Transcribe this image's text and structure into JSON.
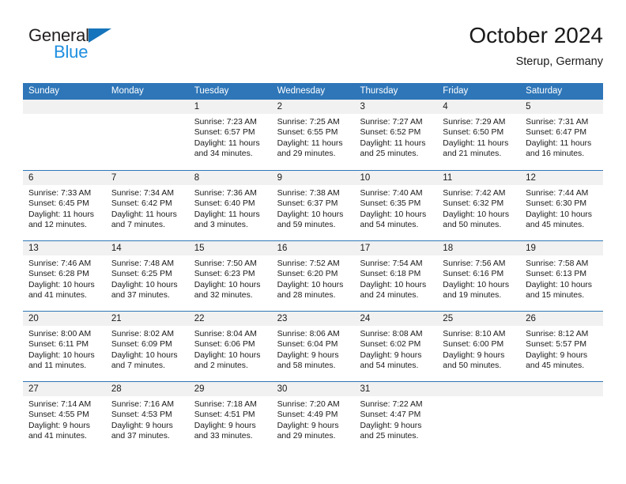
{
  "brand": {
    "name_top": "General",
    "name_bottom": "Blue",
    "triangle_icon": "triangle-icon",
    "color_dark": "#231f20",
    "color_blue": "#1f8fe0"
  },
  "header": {
    "title": "October 2024",
    "subtitle": "Sterup, Germany"
  },
  "theme": {
    "header_blue": "#2e76b8",
    "daynum_band": "#f1f1f1",
    "text": "#1a1a1a"
  },
  "weekdays": [
    "Sunday",
    "Monday",
    "Tuesday",
    "Wednesday",
    "Thursday",
    "Friday",
    "Saturday"
  ],
  "weeks": [
    [
      {
        "day": "",
        "lines": []
      },
      {
        "day": "",
        "lines": []
      },
      {
        "day": "1",
        "lines": [
          "Sunrise: 7:23 AM",
          "Sunset: 6:57 PM",
          "Daylight: 11 hours",
          "and 34 minutes."
        ]
      },
      {
        "day": "2",
        "lines": [
          "Sunrise: 7:25 AM",
          "Sunset: 6:55 PM",
          "Daylight: 11 hours",
          "and 29 minutes."
        ]
      },
      {
        "day": "3",
        "lines": [
          "Sunrise: 7:27 AM",
          "Sunset: 6:52 PM",
          "Daylight: 11 hours",
          "and 25 minutes."
        ]
      },
      {
        "day": "4",
        "lines": [
          "Sunrise: 7:29 AM",
          "Sunset: 6:50 PM",
          "Daylight: 11 hours",
          "and 21 minutes."
        ]
      },
      {
        "day": "5",
        "lines": [
          "Sunrise: 7:31 AM",
          "Sunset: 6:47 PM",
          "Daylight: 11 hours",
          "and 16 minutes."
        ]
      }
    ],
    [
      {
        "day": "6",
        "lines": [
          "Sunrise: 7:33 AM",
          "Sunset: 6:45 PM",
          "Daylight: 11 hours",
          "and 12 minutes."
        ]
      },
      {
        "day": "7",
        "lines": [
          "Sunrise: 7:34 AM",
          "Sunset: 6:42 PM",
          "Daylight: 11 hours",
          "and 7 minutes."
        ]
      },
      {
        "day": "8",
        "lines": [
          "Sunrise: 7:36 AM",
          "Sunset: 6:40 PM",
          "Daylight: 11 hours",
          "and 3 minutes."
        ]
      },
      {
        "day": "9",
        "lines": [
          "Sunrise: 7:38 AM",
          "Sunset: 6:37 PM",
          "Daylight: 10 hours",
          "and 59 minutes."
        ]
      },
      {
        "day": "10",
        "lines": [
          "Sunrise: 7:40 AM",
          "Sunset: 6:35 PM",
          "Daylight: 10 hours",
          "and 54 minutes."
        ]
      },
      {
        "day": "11",
        "lines": [
          "Sunrise: 7:42 AM",
          "Sunset: 6:32 PM",
          "Daylight: 10 hours",
          "and 50 minutes."
        ]
      },
      {
        "day": "12",
        "lines": [
          "Sunrise: 7:44 AM",
          "Sunset: 6:30 PM",
          "Daylight: 10 hours",
          "and 45 minutes."
        ]
      }
    ],
    [
      {
        "day": "13",
        "lines": [
          "Sunrise: 7:46 AM",
          "Sunset: 6:28 PM",
          "Daylight: 10 hours",
          "and 41 minutes."
        ]
      },
      {
        "day": "14",
        "lines": [
          "Sunrise: 7:48 AM",
          "Sunset: 6:25 PM",
          "Daylight: 10 hours",
          "and 37 minutes."
        ]
      },
      {
        "day": "15",
        "lines": [
          "Sunrise: 7:50 AM",
          "Sunset: 6:23 PM",
          "Daylight: 10 hours",
          "and 32 minutes."
        ]
      },
      {
        "day": "16",
        "lines": [
          "Sunrise: 7:52 AM",
          "Sunset: 6:20 PM",
          "Daylight: 10 hours",
          "and 28 minutes."
        ]
      },
      {
        "day": "17",
        "lines": [
          "Sunrise: 7:54 AM",
          "Sunset: 6:18 PM",
          "Daylight: 10 hours",
          "and 24 minutes."
        ]
      },
      {
        "day": "18",
        "lines": [
          "Sunrise: 7:56 AM",
          "Sunset: 6:16 PM",
          "Daylight: 10 hours",
          "and 19 minutes."
        ]
      },
      {
        "day": "19",
        "lines": [
          "Sunrise: 7:58 AM",
          "Sunset: 6:13 PM",
          "Daylight: 10 hours",
          "and 15 minutes."
        ]
      }
    ],
    [
      {
        "day": "20",
        "lines": [
          "Sunrise: 8:00 AM",
          "Sunset: 6:11 PM",
          "Daylight: 10 hours",
          "and 11 minutes."
        ]
      },
      {
        "day": "21",
        "lines": [
          "Sunrise: 8:02 AM",
          "Sunset: 6:09 PM",
          "Daylight: 10 hours",
          "and 7 minutes."
        ]
      },
      {
        "day": "22",
        "lines": [
          "Sunrise: 8:04 AM",
          "Sunset: 6:06 PM",
          "Daylight: 10 hours",
          "and 2 minutes."
        ]
      },
      {
        "day": "23",
        "lines": [
          "Sunrise: 8:06 AM",
          "Sunset: 6:04 PM",
          "Daylight: 9 hours",
          "and 58 minutes."
        ]
      },
      {
        "day": "24",
        "lines": [
          "Sunrise: 8:08 AM",
          "Sunset: 6:02 PM",
          "Daylight: 9 hours",
          "and 54 minutes."
        ]
      },
      {
        "day": "25",
        "lines": [
          "Sunrise: 8:10 AM",
          "Sunset: 6:00 PM",
          "Daylight: 9 hours",
          "and 50 minutes."
        ]
      },
      {
        "day": "26",
        "lines": [
          "Sunrise: 8:12 AM",
          "Sunset: 5:57 PM",
          "Daylight: 9 hours",
          "and 45 minutes."
        ]
      }
    ],
    [
      {
        "day": "27",
        "lines": [
          "Sunrise: 7:14 AM",
          "Sunset: 4:55 PM",
          "Daylight: 9 hours",
          "and 41 minutes."
        ]
      },
      {
        "day": "28",
        "lines": [
          "Sunrise: 7:16 AM",
          "Sunset: 4:53 PM",
          "Daylight: 9 hours",
          "and 37 minutes."
        ]
      },
      {
        "day": "29",
        "lines": [
          "Sunrise: 7:18 AM",
          "Sunset: 4:51 PM",
          "Daylight: 9 hours",
          "and 33 minutes."
        ]
      },
      {
        "day": "30",
        "lines": [
          "Sunrise: 7:20 AM",
          "Sunset: 4:49 PM",
          "Daylight: 9 hours",
          "and 29 minutes."
        ]
      },
      {
        "day": "31",
        "lines": [
          "Sunrise: 7:22 AM",
          "Sunset: 4:47 PM",
          "Daylight: 9 hours",
          "and 25 minutes."
        ]
      },
      {
        "day": "",
        "lines": []
      },
      {
        "day": "",
        "lines": []
      }
    ]
  ]
}
